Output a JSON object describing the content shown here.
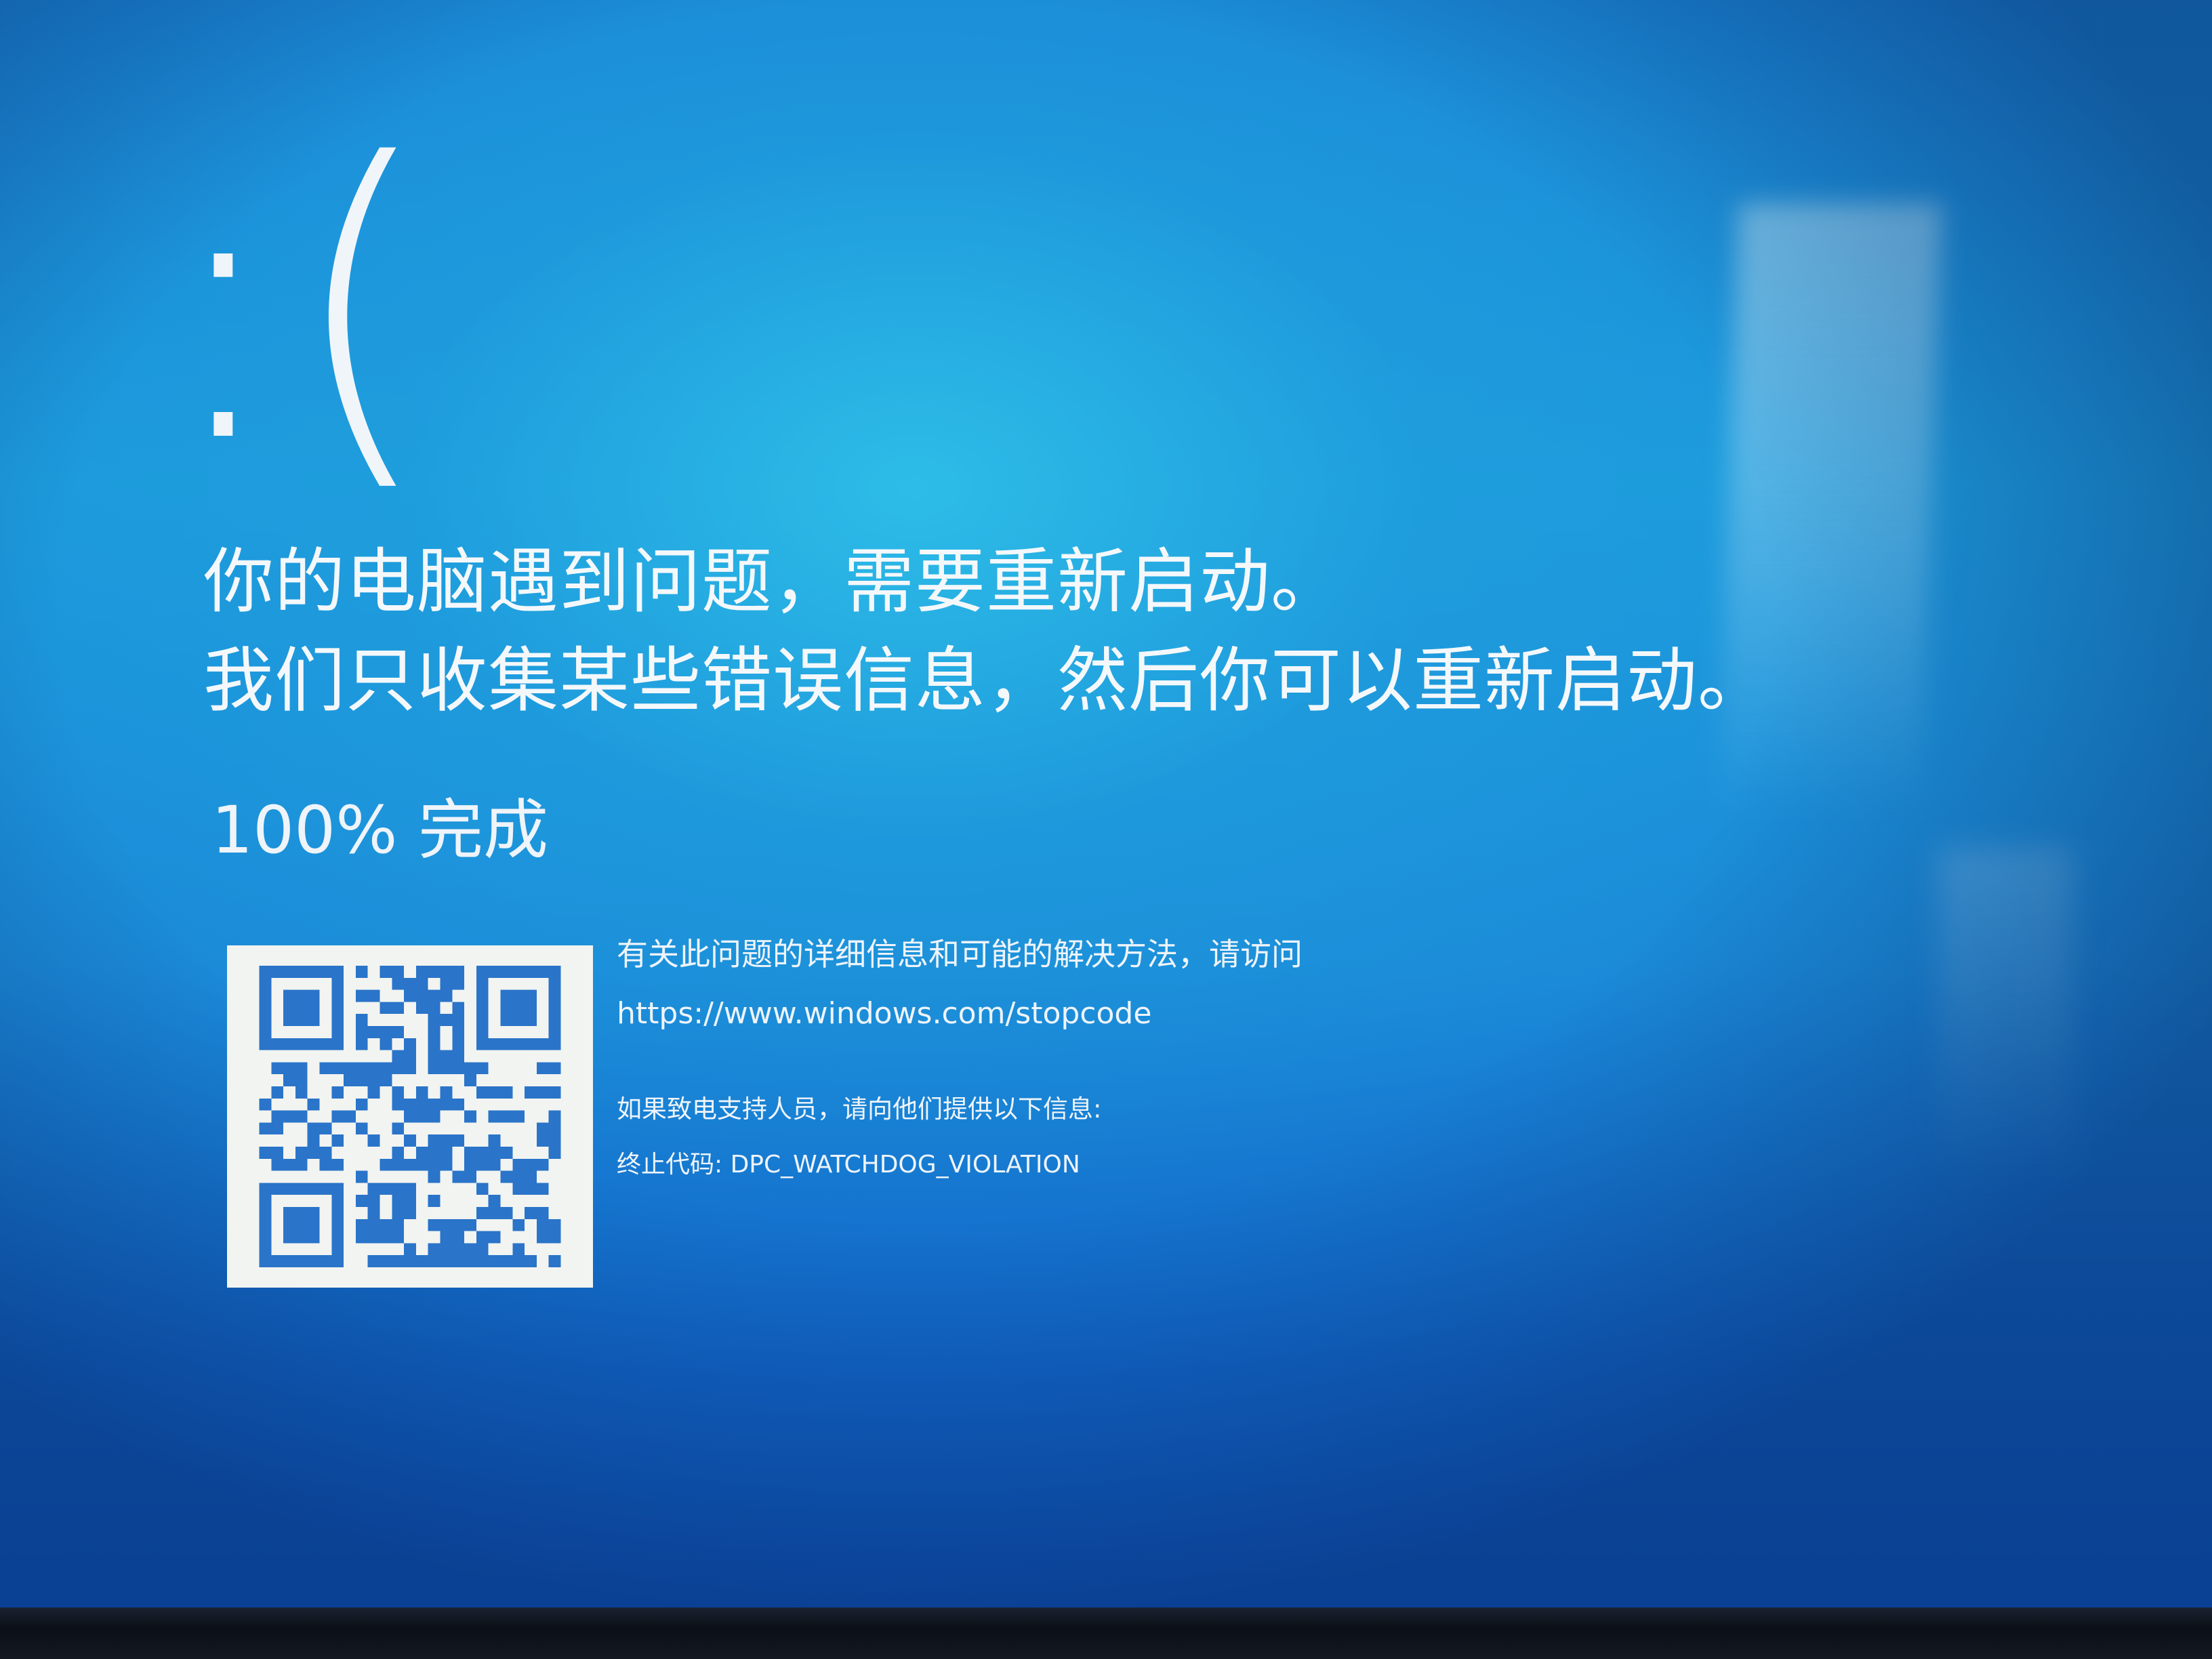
{
  "bsod": {
    "sad_face": ":(",
    "headline_line1": "你的电脑遇到问题，需要重新启动。",
    "headline_line2": "我们只收集某些错误信息，然后你可以重新启动。",
    "progress": "100% 完成",
    "info_text": "有关此问题的详细信息和可能的解决方法，请访问",
    "url": "https://www.windows.com/stopcode",
    "support_text": "如果致电支持人员，请向他们提供以下信息:",
    "stop_code_label": "终止代码: ",
    "stop_code": "DPC_WATCHDOG_VIOLATION"
  },
  "colors": {
    "background": "#1b9ddc",
    "text": "#f3f7fb",
    "qr_dark": "#2a74c9",
    "qr_light": "#f2f4f1"
  },
  "icons": {
    "qr": "qr-code-icon"
  }
}
